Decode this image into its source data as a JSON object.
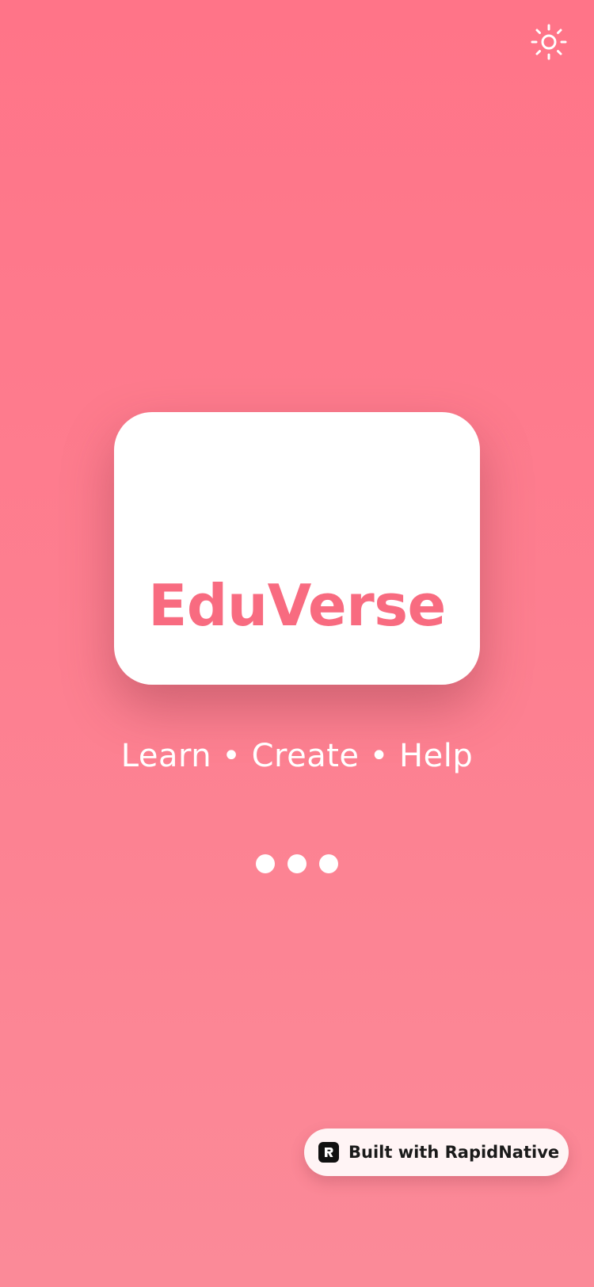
{
  "header": {
    "theme_toggle_icon": "sun-icon"
  },
  "splash": {
    "app_name": "EduVerse",
    "tagline": "Learn • Create • Help",
    "loading_indicator": {
      "dots": 3
    }
  },
  "badge": {
    "icon": "rapidnative-logo-icon",
    "label": "Built with RapidNative"
  },
  "colors": {
    "background_top": "#FF7488",
    "background_bottom": "#FB8A98",
    "brand": "#F86B80",
    "card": "#FFFFFF",
    "text_light": "#FFFFFF"
  }
}
